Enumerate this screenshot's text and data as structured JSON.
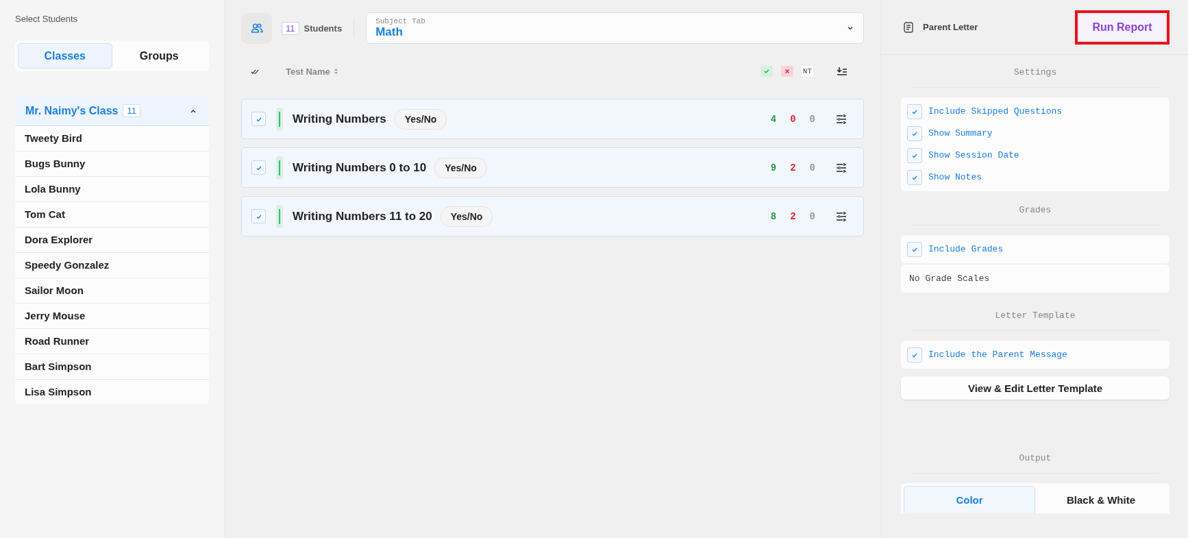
{
  "student_panel": {
    "title": "Select Students",
    "tabs": [
      {
        "label": "Classes",
        "selected": true
      },
      {
        "label": "Groups",
        "selected": false
      }
    ],
    "class_group": {
      "name": "Mr. Naimy's Class",
      "count": "11",
      "expanded": true,
      "students": [
        "Tweety Bird",
        "Bugs Bunny",
        "Lola Bunny",
        "Tom Cat",
        "Dora Explorer",
        "Speedy Gonzalez",
        "Sailor Moon",
        "Jerry Mouse",
        "Road Runner",
        "Bart Simpson",
        "Lisa Simpson"
      ]
    }
  },
  "toolbar": {
    "student_count": "11",
    "students_label": "Students",
    "subject_select": {
      "label": "Subject Tab",
      "value": "Math"
    }
  },
  "test_table": {
    "columns": {
      "name": "Test Name",
      "not_tested": "NT"
    },
    "rows": [
      {
        "name": "Writing Numbers",
        "type": "Yes/No",
        "checked": true,
        "correct": "4",
        "incorrect": "0",
        "not_tested": "0"
      },
      {
        "name": "Writing Numbers 0 to 10",
        "type": "Yes/No",
        "checked": true,
        "correct": "9",
        "incorrect": "2",
        "not_tested": "0"
      },
      {
        "name": "Writing Numbers 11 to 20",
        "type": "Yes/No",
        "checked": true,
        "correct": "8",
        "incorrect": "2",
        "not_tested": "0"
      }
    ]
  },
  "report_panel": {
    "title": "Parent Letter",
    "run_button": {
      "label": "Run Report",
      "highlighted": true
    },
    "sections": [
      {
        "heading": "Settings",
        "options": [
          {
            "label": "Include Skipped Questions",
            "checked": true
          },
          {
            "label": "Show Summary",
            "checked": true
          },
          {
            "label": "Show Session Date",
            "checked": true
          },
          {
            "label": "Show Notes",
            "checked": true
          }
        ]
      },
      {
        "heading": "Grades",
        "options": [
          {
            "label": "Include Grades",
            "checked": true
          }
        ],
        "note": "No Grade Scales"
      },
      {
        "heading": "Letter Template",
        "options": [
          {
            "label": "Include the Parent Message",
            "checked": true
          }
        ],
        "button": "View & Edit Letter Template"
      }
    ],
    "output": {
      "heading": "Output",
      "choices": [
        {
          "label": "Color",
          "selected": true
        },
        {
          "label": "Black & White",
          "selected": false
        }
      ]
    }
  }
}
